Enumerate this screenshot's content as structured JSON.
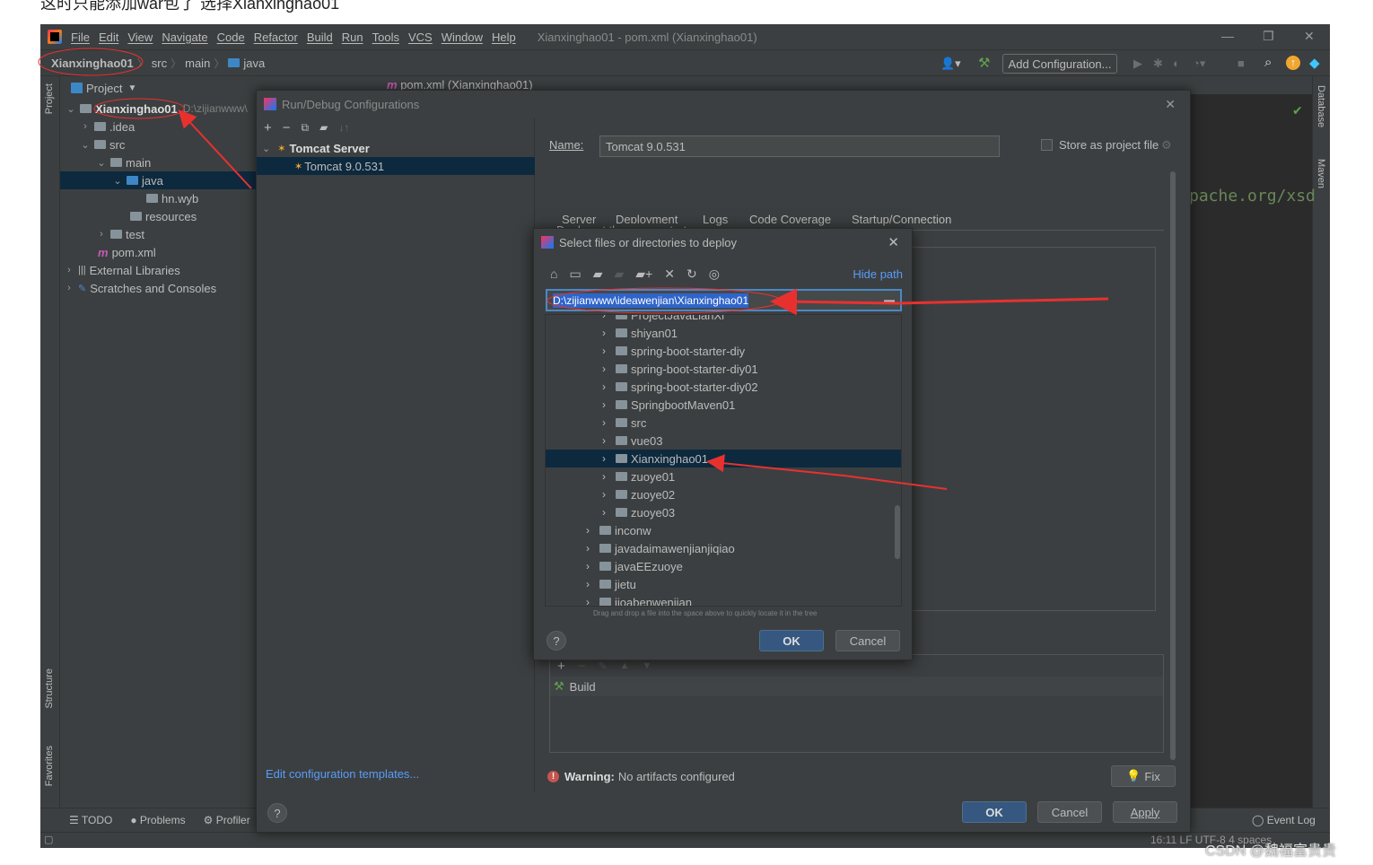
{
  "top_caption": "这时只能添加war包了 选择Xianxinghao01",
  "menu": {
    "items": [
      "File",
      "Edit",
      "View",
      "Navigate",
      "Code",
      "Refactor",
      "Build",
      "Run",
      "Tools",
      "VCS",
      "Window",
      "Help"
    ],
    "window_title": "Xianxinghao01 - pom.xml (Xianxinghao01)"
  },
  "navbar": {
    "crumbs": [
      "Xianxinghao01",
      "src",
      "main",
      "java"
    ],
    "add_config_label": "Add Configuration..."
  },
  "left_strip": {
    "project": "Project",
    "structure": "Structure",
    "favorites": "Favorites"
  },
  "right_strip": {
    "database": "Database",
    "maven": "Maven"
  },
  "project_panel": {
    "header": "Project",
    "rows": [
      {
        "label": "Xianxinghao01",
        "extra": "D:\\zijianwww\\"
      },
      {
        "label": ".idea"
      },
      {
        "label": "src"
      },
      {
        "label": "main"
      },
      {
        "label": "java"
      },
      {
        "label": "hn.wyb"
      },
      {
        "label": "resources"
      },
      {
        "label": "test"
      },
      {
        "label": "pom.xml"
      },
      {
        "label": "External Libraries"
      },
      {
        "label": "Scratches and Consoles"
      }
    ]
  },
  "editor": {
    "tab_label": "pom.xml (Xianxinghao01)",
    "code_fragment": "pache.org/xsd"
  },
  "bottom_bar": {
    "items": [
      "TODO",
      "Problems",
      "Profiler"
    ],
    "event_log": "Event Log",
    "status": "16:11  LF  UTF-8  4 spaces"
  },
  "run_debug_dialog": {
    "title": "Run/Debug Configurations",
    "tree": [
      {
        "label": "Tomcat Server"
      },
      {
        "label": "Tomcat 9.0.531"
      }
    ],
    "edit_templates_link": "Edit configuration templates...",
    "name_label": "Name:",
    "name_value": "Tomcat 9.0.531",
    "store_as_project_file": "Store as project file",
    "tabs": [
      "Server",
      "Deployment",
      "Logs",
      "Code Coverage",
      "Startup/Connection"
    ],
    "active_tab": "Deployment",
    "deploy_label": "Deploy at the server startup",
    "before_launch_item": "Build",
    "warning_label": "Warning:",
    "warning_text": "No artifacts configured",
    "fix_label": "Fix",
    "ok": "OK",
    "cancel": "Cancel",
    "apply": "Apply"
  },
  "select_dialog": {
    "title": "Select files or directories to deploy",
    "hide_path": "Hide path",
    "path_value": "D:\\zijianwww\\ideawenjian\\Xianxinghao01",
    "hint": "Drag and drop a file into the space above to quickly locate it in the tree",
    "rows": [
      {
        "label": "ProjectJavaLianXi",
        "indent": 2
      },
      {
        "label": "shiyan01",
        "indent": 2
      },
      {
        "label": "spring-boot-starter-diy",
        "indent": 2
      },
      {
        "label": "spring-boot-starter-diy01",
        "indent": 2
      },
      {
        "label": "spring-boot-starter-diy02",
        "indent": 2
      },
      {
        "label": "SpringbootMaven01",
        "indent": 2
      },
      {
        "label": "src",
        "indent": 2
      },
      {
        "label": "vue03",
        "indent": 2
      },
      {
        "label": "Xianxinghao01",
        "indent": 2,
        "selected": true
      },
      {
        "label": "zuoye01",
        "indent": 2
      },
      {
        "label": "zuoye02",
        "indent": 2
      },
      {
        "label": "zuoye03",
        "indent": 2
      },
      {
        "label": "inconw",
        "indent": 1
      },
      {
        "label": "javadaimawenjianjiqiao",
        "indent": 1
      },
      {
        "label": "javaEEzuoye",
        "indent": 1
      },
      {
        "label": "jietu",
        "indent": 1
      },
      {
        "label": "jioabenwenjian",
        "indent": 1
      }
    ],
    "ok": "OK",
    "cancel": "Cancel"
  },
  "watermark": "CSDN @魏福富贵贵",
  "colors": {
    "ide_bg": "#3c3f41",
    "editor_bg": "#2b2b2b",
    "selection": "#0d293e",
    "accent": "#4a88c7",
    "link": "#589df6",
    "annotation_red": "#e8312f"
  }
}
